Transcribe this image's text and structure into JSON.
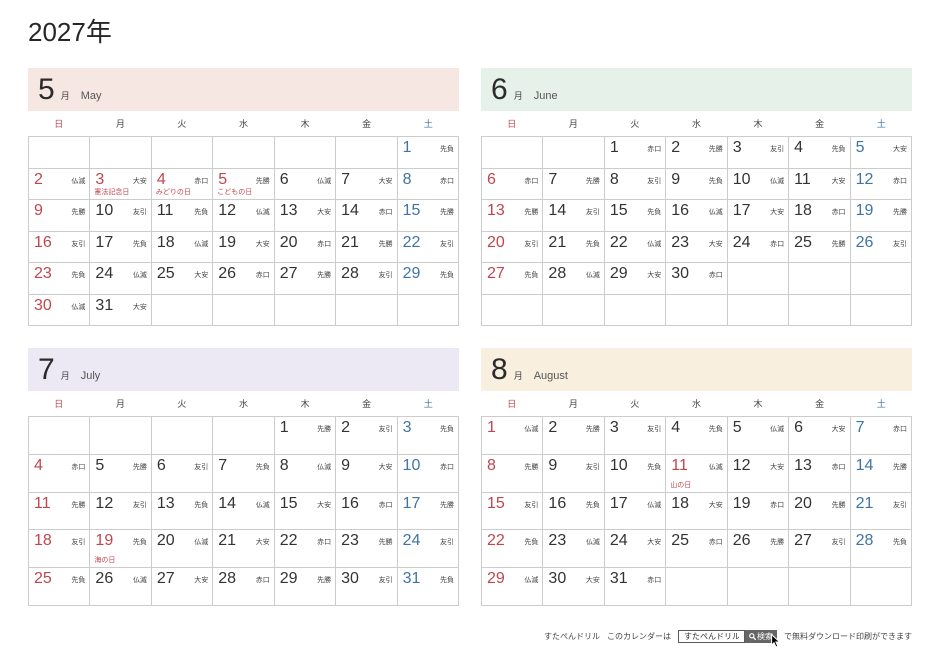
{
  "title": "2027年",
  "weekdays": [
    "日",
    "月",
    "火",
    "水",
    "木",
    "金",
    "土"
  ],
  "colors": {
    "text": "#333333",
    "sunday": "#c0464e",
    "saturday": "#3f74a6",
    "holiday": "#c0464e",
    "grid_line": "#cccccc"
  },
  "months": [
    {
      "number": "5",
      "unit": "月",
      "name_en": "May",
      "header_color": "#f6e7e3",
      "weeks": [
        [
          null,
          null,
          null,
          null,
          null,
          null,
          {
            "day": "1",
            "rokuyo": "先負"
          }
        ],
        [
          {
            "day": "2",
            "rokuyo": "仏滅"
          },
          {
            "day": "3",
            "rokuyo": "大安",
            "holiday": "憲法記念日"
          },
          {
            "day": "4",
            "rokuyo": "赤口",
            "holiday": "みどりの日"
          },
          {
            "day": "5",
            "rokuyo": "先勝",
            "holiday": "こどもの日"
          },
          {
            "day": "6",
            "rokuyo": "仏滅"
          },
          {
            "day": "7",
            "rokuyo": "大安"
          },
          {
            "day": "8",
            "rokuyo": "赤口"
          }
        ],
        [
          {
            "day": "9",
            "rokuyo": "先勝"
          },
          {
            "day": "10",
            "rokuyo": "友引"
          },
          {
            "day": "11",
            "rokuyo": "先負"
          },
          {
            "day": "12",
            "rokuyo": "仏滅"
          },
          {
            "day": "13",
            "rokuyo": "大安"
          },
          {
            "day": "14",
            "rokuyo": "赤口"
          },
          {
            "day": "15",
            "rokuyo": "先勝"
          }
        ],
        [
          {
            "day": "16",
            "rokuyo": "友引"
          },
          {
            "day": "17",
            "rokuyo": "先負"
          },
          {
            "day": "18",
            "rokuyo": "仏滅"
          },
          {
            "day": "19",
            "rokuyo": "大安"
          },
          {
            "day": "20",
            "rokuyo": "赤口"
          },
          {
            "day": "21",
            "rokuyo": "先勝"
          },
          {
            "day": "22",
            "rokuyo": "友引"
          }
        ],
        [
          {
            "day": "23",
            "rokuyo": "先負"
          },
          {
            "day": "24",
            "rokuyo": "仏滅"
          },
          {
            "day": "25",
            "rokuyo": "大安"
          },
          {
            "day": "26",
            "rokuyo": "赤口"
          },
          {
            "day": "27",
            "rokuyo": "先勝"
          },
          {
            "day": "28",
            "rokuyo": "友引"
          },
          {
            "day": "29",
            "rokuyo": "先負"
          }
        ],
        [
          {
            "day": "30",
            "rokuyo": "仏滅"
          },
          {
            "day": "31",
            "rokuyo": "大安"
          },
          null,
          null,
          null,
          null,
          null
        ]
      ]
    },
    {
      "number": "6",
      "unit": "月",
      "name_en": "June",
      "header_color": "#e6f1ea",
      "weeks": [
        [
          null,
          null,
          {
            "day": "1",
            "rokuyo": "赤口"
          },
          {
            "day": "2",
            "rokuyo": "先勝"
          },
          {
            "day": "3",
            "rokuyo": "友引"
          },
          {
            "day": "4",
            "rokuyo": "先負"
          },
          {
            "day": "5",
            "rokuyo": "大安"
          }
        ],
        [
          {
            "day": "6",
            "rokuyo": "赤口"
          },
          {
            "day": "7",
            "rokuyo": "先勝"
          },
          {
            "day": "8",
            "rokuyo": "友引"
          },
          {
            "day": "9",
            "rokuyo": "先負"
          },
          {
            "day": "10",
            "rokuyo": "仏滅"
          },
          {
            "day": "11",
            "rokuyo": "大安"
          },
          {
            "day": "12",
            "rokuyo": "赤口"
          }
        ],
        [
          {
            "day": "13",
            "rokuyo": "先勝"
          },
          {
            "day": "14",
            "rokuyo": "友引"
          },
          {
            "day": "15",
            "rokuyo": "先負"
          },
          {
            "day": "16",
            "rokuyo": "仏滅"
          },
          {
            "day": "17",
            "rokuyo": "大安"
          },
          {
            "day": "18",
            "rokuyo": "赤口"
          },
          {
            "day": "19",
            "rokuyo": "先勝"
          }
        ],
        [
          {
            "day": "20",
            "rokuyo": "友引"
          },
          {
            "day": "21",
            "rokuyo": "先負"
          },
          {
            "day": "22",
            "rokuyo": "仏滅"
          },
          {
            "day": "23",
            "rokuyo": "大安"
          },
          {
            "day": "24",
            "rokuyo": "赤口"
          },
          {
            "day": "25",
            "rokuyo": "先勝"
          },
          {
            "day": "26",
            "rokuyo": "友引"
          }
        ],
        [
          {
            "day": "27",
            "rokuyo": "先負"
          },
          {
            "day": "28",
            "rokuyo": "仏滅"
          },
          {
            "day": "29",
            "rokuyo": "大安"
          },
          {
            "day": "30",
            "rokuyo": "赤口"
          },
          null,
          null,
          null
        ],
        [
          null,
          null,
          null,
          null,
          null,
          null,
          null
        ]
      ]
    },
    {
      "number": "7",
      "unit": "月",
      "name_en": "July",
      "header_color": "#ece8f4",
      "weeks": [
        [
          null,
          null,
          null,
          null,
          {
            "day": "1",
            "rokuyo": "先勝"
          },
          {
            "day": "2",
            "rokuyo": "友引"
          },
          {
            "day": "3",
            "rokuyo": "先負"
          }
        ],
        [
          {
            "day": "4",
            "rokuyo": "赤口"
          },
          {
            "day": "5",
            "rokuyo": "先勝"
          },
          {
            "day": "6",
            "rokuyo": "友引"
          },
          {
            "day": "7",
            "rokuyo": "先負"
          },
          {
            "day": "8",
            "rokuyo": "仏滅"
          },
          {
            "day": "9",
            "rokuyo": "大安"
          },
          {
            "day": "10",
            "rokuyo": "赤口"
          }
        ],
        [
          {
            "day": "11",
            "rokuyo": "先勝"
          },
          {
            "day": "12",
            "rokuyo": "友引"
          },
          {
            "day": "13",
            "rokuyo": "先負"
          },
          {
            "day": "14",
            "rokuyo": "仏滅"
          },
          {
            "day": "15",
            "rokuyo": "大安"
          },
          {
            "day": "16",
            "rokuyo": "赤口"
          },
          {
            "day": "17",
            "rokuyo": "先勝"
          }
        ],
        [
          {
            "day": "18",
            "rokuyo": "友引"
          },
          {
            "day": "19",
            "rokuyo": "先負",
            "holiday": "海の日"
          },
          {
            "day": "20",
            "rokuyo": "仏滅"
          },
          {
            "day": "21",
            "rokuyo": "大安"
          },
          {
            "day": "22",
            "rokuyo": "赤口"
          },
          {
            "day": "23",
            "rokuyo": "先勝"
          },
          {
            "day": "24",
            "rokuyo": "友引"
          }
        ],
        [
          {
            "day": "25",
            "rokuyo": "先負"
          },
          {
            "day": "26",
            "rokuyo": "仏滅"
          },
          {
            "day": "27",
            "rokuyo": "大安"
          },
          {
            "day": "28",
            "rokuyo": "赤口"
          },
          {
            "day": "29",
            "rokuyo": "先勝"
          },
          {
            "day": "30",
            "rokuyo": "友引"
          },
          {
            "day": "31",
            "rokuyo": "先負"
          }
        ]
      ]
    },
    {
      "number": "8",
      "unit": "月",
      "name_en": "August",
      "header_color": "#f8efde",
      "weeks": [
        [
          {
            "day": "1",
            "rokuyo": "仏滅"
          },
          {
            "day": "2",
            "rokuyo": "先勝"
          },
          {
            "day": "3",
            "rokuyo": "友引"
          },
          {
            "day": "4",
            "rokuyo": "先負"
          },
          {
            "day": "5",
            "rokuyo": "仏滅"
          },
          {
            "day": "6",
            "rokuyo": "大安"
          },
          {
            "day": "7",
            "rokuyo": "赤口"
          }
        ],
        [
          {
            "day": "8",
            "rokuyo": "先勝"
          },
          {
            "day": "9",
            "rokuyo": "友引"
          },
          {
            "day": "10",
            "rokuyo": "先負"
          },
          {
            "day": "11",
            "rokuyo": "仏滅",
            "holiday": "山の日"
          },
          {
            "day": "12",
            "rokuyo": "大安"
          },
          {
            "day": "13",
            "rokuyo": "赤口"
          },
          {
            "day": "14",
            "rokuyo": "先勝"
          }
        ],
        [
          {
            "day": "15",
            "rokuyo": "友引"
          },
          {
            "day": "16",
            "rokuyo": "先負"
          },
          {
            "day": "17",
            "rokuyo": "仏滅"
          },
          {
            "day": "18",
            "rokuyo": "大安"
          },
          {
            "day": "19",
            "rokuyo": "赤口"
          },
          {
            "day": "20",
            "rokuyo": "先勝"
          },
          {
            "day": "21",
            "rokuyo": "友引"
          }
        ],
        [
          {
            "day": "22",
            "rokuyo": "先負"
          },
          {
            "day": "23",
            "rokuyo": "仏滅"
          },
          {
            "day": "24",
            "rokuyo": "大安"
          },
          {
            "day": "25",
            "rokuyo": "赤口"
          },
          {
            "day": "26",
            "rokuyo": "先勝"
          },
          {
            "day": "27",
            "rokuyo": "友引"
          },
          {
            "day": "28",
            "rokuyo": "先負"
          }
        ],
        [
          {
            "day": "29",
            "rokuyo": "仏滅"
          },
          {
            "day": "30",
            "rokuyo": "大安"
          },
          {
            "day": "31",
            "rokuyo": "赤口"
          },
          null,
          null,
          null,
          null
        ]
      ]
    }
  ],
  "footer": {
    "brand": "すたぺんドリル",
    "text_before": "このカレンダーは",
    "search_value": "すたぺんドリル",
    "search_button": "検索",
    "search_icon": "search-icon",
    "cursor_icon": "mouse-cursor-icon",
    "text_after": "で無料ダウンロード印刷ができます"
  }
}
